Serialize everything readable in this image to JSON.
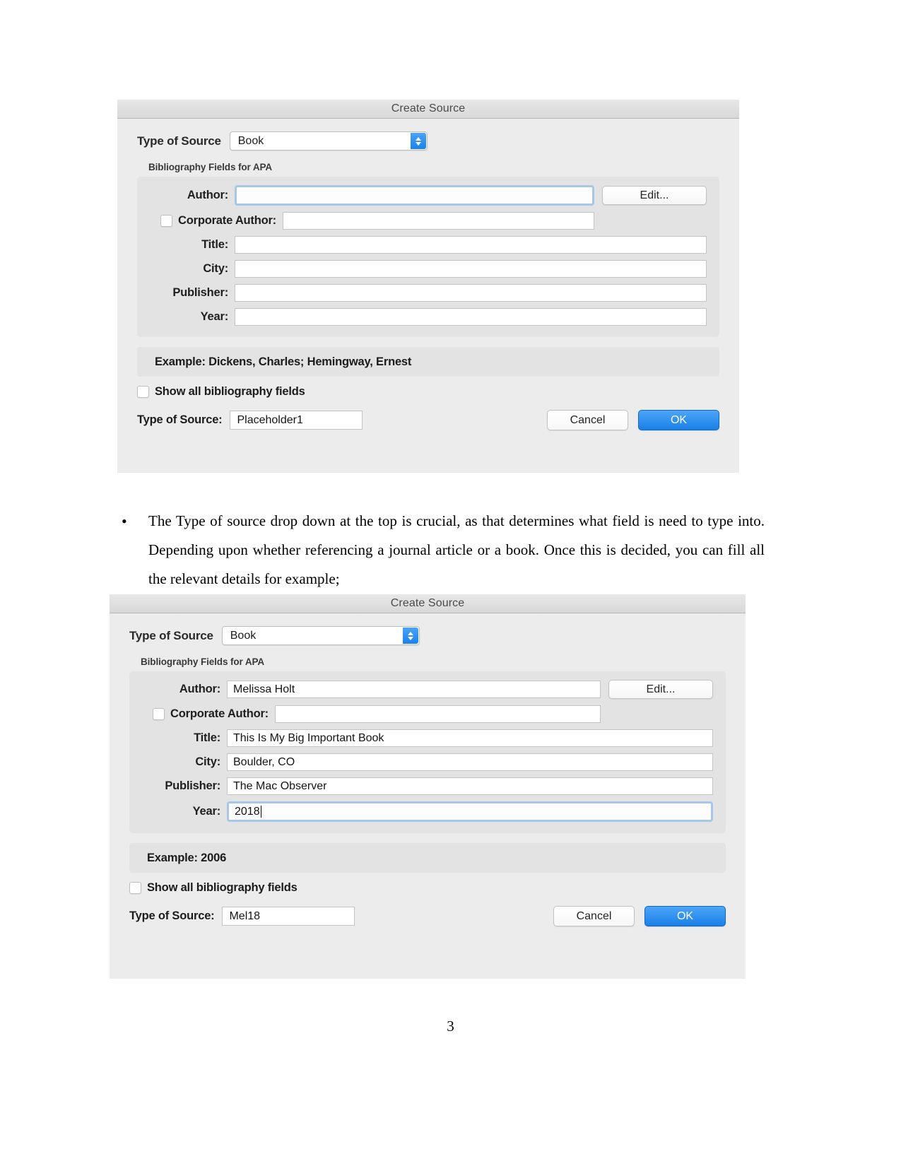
{
  "document": {
    "page_number": "3",
    "bullet_marker": "•",
    "paragraph": "The Type of source drop down at the  top is crucial, as that determines what field is need to type into. Depending upon whether referencing a journal article or a book. Once this is decided, you can fill all the relevant details for example;"
  },
  "dialog_empty": {
    "title": "Create Source",
    "type_of_source_label": "Type of Source",
    "type_of_source_value": "Book",
    "group_caption": "Bibliography Fields for APA",
    "fields": [
      {
        "label": "Author:",
        "value": "",
        "focused": true
      },
      {
        "label": "Title:",
        "value": "",
        "focused": false
      },
      {
        "label": "City:",
        "value": "",
        "focused": false
      },
      {
        "label": "Publisher:",
        "value": "",
        "focused": false
      },
      {
        "label": "Year:",
        "value": "",
        "focused": false
      }
    ],
    "edit_button_label": "Edit...",
    "corporate_author_label": "Corporate Author:",
    "corporate_author_value": "",
    "example_text": "Example: Dickens, Charles; Hemingway, Ernest",
    "show_all_label": "Show all bibliography fields",
    "bottom_label": "Type of Source:",
    "tag_value": "Placeholder1",
    "cancel_label": "Cancel",
    "ok_label": "OK"
  },
  "dialog_filled": {
    "title": "Create Source",
    "type_of_source_label": "Type of Source",
    "type_of_source_value": "Book",
    "group_caption": "Bibliography Fields for APA",
    "fields": [
      {
        "label": "Author:",
        "value": "Melissa Holt",
        "focused": false
      },
      {
        "label": "Title:",
        "value": "This Is My Big Important Book",
        "focused": false
      },
      {
        "label": "City:",
        "value": "Boulder, CO",
        "focused": false
      },
      {
        "label": "Publisher:",
        "value": "The Mac Observer",
        "focused": false
      },
      {
        "label": "Year:",
        "value": "2018",
        "focused": true
      }
    ],
    "edit_button_label": "Edit...",
    "corporate_author_label": "Corporate Author:",
    "corporate_author_value": "",
    "example_text": "Example: 2006",
    "show_all_label": "Show all bibliography fields",
    "bottom_label": "Type of Source:",
    "tag_value": "Mel18",
    "cancel_label": "Cancel",
    "ok_label": "OK"
  },
  "colors": {
    "accent_blue": "#1a7fe8",
    "dialog_bg": "#ececec",
    "group_bg": "#e3e3e3",
    "focus_ring": "#a8c6e8"
  }
}
